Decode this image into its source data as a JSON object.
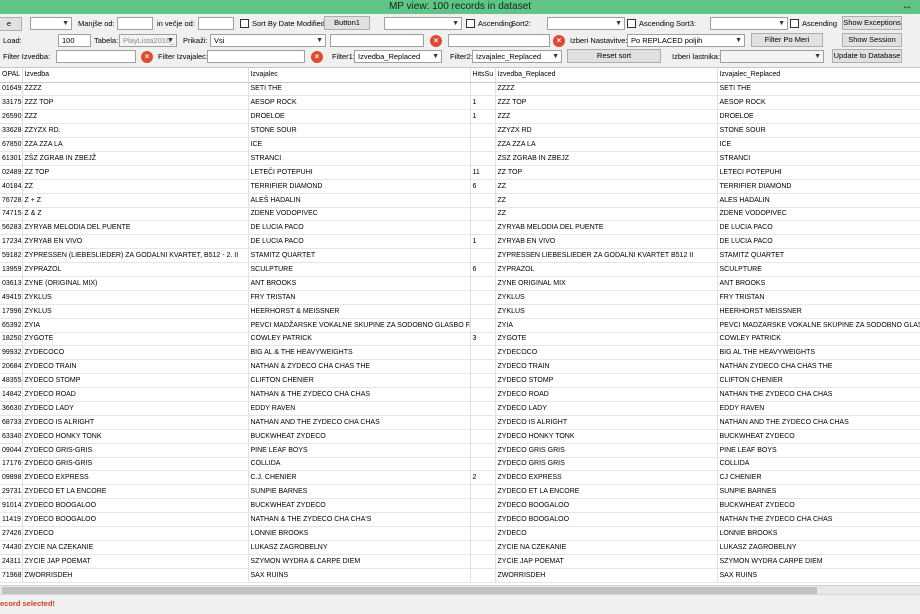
{
  "window": {
    "title": "MP view: 100 records in dataset",
    "resize_glyph": "↔"
  },
  "toolbar1": {
    "edge_button": "e",
    "manjse_label": "Manjše od:",
    "vecje_label": "in večje od:",
    "sort_by_date_label": "Sort By Date Modified",
    "button1_label": "Button1",
    "ascending1_label": "Ascending",
    "sort2_label": "Sort2:",
    "ascending2_label": "Ascending",
    "sort3_label": "Sort3:",
    "ascending3_label": "Ascending",
    "show_exceptions_label": "Show Exceptions"
  },
  "toolbar2": {
    "load_label": "Load:",
    "load_value": "100",
    "tabela_label": "Tabela:",
    "tabela_value": "PlayLista2016_",
    "prikazi_label": "Prikaži:",
    "prikazi_value": "Vsi",
    "izberi_nastavitve_label": "Izberi Nastavitve:",
    "nastavitve_value": "Po REPLACED poljih",
    "filter_po_meri_label": "Filter Po Meri",
    "show_session_label": "Show Session"
  },
  "toolbar3": {
    "filter_izvedba_label": "Filter Izvedba:",
    "filter_izvajalec_label": "Filter Izvajalec:",
    "filter1_label": "Filter1:",
    "filter1_value": "Izvedba_Replaced",
    "filter2_label": "Filter2:",
    "filter2_value": "Izvajalec_Replaced",
    "reset_sort_label": "Reset sort",
    "izberi_lastnika_label": "Izberi lastnika:",
    "update_db_label": "Update to Database"
  },
  "grid": {
    "columns": [
      "OPAL",
      "Izvedba",
      "Izvajalec",
      "HitsSu",
      "Izvedba_Replaced",
      "Izvajalec_Replaced"
    ],
    "rows": [
      [
        "01649",
        "ZZZZ",
        "SETI THE",
        "",
        "ZZZZ",
        "SETI THE"
      ],
      [
        "33175",
        "ZZZ TOP",
        "AESOP ROCK",
        "1",
        "ZZZ TOP",
        "AESOP ROCK"
      ],
      [
        "26590",
        "ZZZ",
        "DROELOE",
        "1",
        "ZZZ",
        "DROELOE"
      ],
      [
        "33628",
        "ZZYZX RD.",
        "STONE SOUR",
        "",
        "ZZYZX RD",
        "STONE SOUR"
      ],
      [
        "67850",
        "ZZA ZZA LA",
        "ICE",
        "",
        "ZZA ZZA LA",
        "ICE"
      ],
      [
        "61301",
        "ZŠZ ZGRAB IN ZBEJŽ",
        "STRANCI",
        "",
        "ZSZ ZGRAB IN ZBEJZ",
        "STRANCI"
      ],
      [
        "02489",
        "ZZ TOP",
        "LETEČI POTEPUHI",
        "11",
        "ZZ TOP",
        "LETECI POTEPUHI"
      ],
      [
        "40184",
        "ZZ",
        "TERRIFIER DIAMOND",
        "6",
        "ZZ",
        "TERRIFIER DIAMOND"
      ],
      [
        "76728",
        "Z + Z",
        "ALEŠ HADALIN",
        "",
        "ZZ",
        "ALES HADALIN"
      ],
      [
        "74715",
        "Z & Z",
        "ZDENE VODOPIVEC",
        "",
        "ZZ",
        "ZDENE VODOPIVEC"
      ],
      [
        "56283",
        "ZYRYAB MELODIA DEL PUENTE",
        "DE LUCIA PACO",
        "",
        "ZYRYAB MELODIA DEL PUENTE",
        "DE LUCIA PACO"
      ],
      [
        "17234",
        "ZYRYAB EN VIVO",
        "DE LUCIA PACO",
        "1",
        "ZYRYAB EN VIVO",
        "DE LUCIA PACO"
      ],
      [
        "59182",
        "ZYPRESSEN (LIEBESLIEDER) ZA GODALNI KVARTET, B512 - 2. II",
        "STAMITZ QUARTET",
        "",
        "ZYPRESSEN LIEBESLIEDER ZA GODALNI KVARTET B512 II",
        "STAMITZ QUARTET"
      ],
      [
        "13959",
        "ZYPRAZOL",
        "SCULPTURE",
        "6",
        "ZYPRAZOL",
        "SCULPTURE"
      ],
      [
        "03613",
        "ZYNE (ORIGINAL MIX)",
        "ANT BROOKS",
        "",
        "ZYNE ORIGINAL MIX",
        "ANT BROOKS"
      ],
      [
        "49415",
        "ZYKLUS",
        "FRY TRISTAN",
        "",
        "ZYKLUS",
        "FRY TRISTAN"
      ],
      [
        "17996",
        "ZYKLUS",
        "HEERHORST & MEISSNER",
        "",
        "ZYKLUS",
        "HEERHORST MEISSNER"
      ],
      [
        "65392",
        "ZYIA",
        "PEVCI MADŽARSKE VOKALNE SKUPINE ZA SODOBNO GLASBO F...",
        "",
        "ZYIA",
        "PEVCI MADZARSKE VOKALNE SKUPINE ZA SODOBNO GLASBO"
      ],
      [
        "18250",
        "ZYGOTE",
        "COWLEY PATRICK",
        "3",
        "ZYGOTE",
        "COWLEY PATRICK"
      ],
      [
        "99932",
        "ZYDECOCO",
        "BIG AL & THE HEAVYWEIGHTS",
        "",
        "ZYDECOCO",
        "BIG AL THE HEAVYWEIGHTS"
      ],
      [
        "20684",
        "ZYDECO TRAIN",
        "NATHAN & ZYDECO CHA CHAS THE",
        "",
        "ZYDECO TRAIN",
        "NATHAN ZYDECO CHA CHAS THE"
      ],
      [
        "48355",
        "ZYDECO STOMP",
        "CLIFTON CHENIER",
        "",
        "ZYDECO STOMP",
        "CLIFTON CHENIER"
      ],
      [
        "14842",
        "ZYDECO ROAD",
        "NATHAN & THE ZYDECO CHA CHAS",
        "",
        "ZYDECO ROAD",
        "NATHAN THE ZYDECO CHA CHAS"
      ],
      [
        "36630",
        "ZYDECO LADY",
        "EDDY RAVEN",
        "",
        "ZYDECO LADY",
        "EDDY RAVEN"
      ],
      [
        "68733",
        "ZYDECO IS ALRIGHT",
        "NATHAN AND THE ZYDECO CHA CHAS",
        "",
        "ZYDECO IS ALRIGHT",
        "NATHAN AND THE ZYDECO CHA CHAS"
      ],
      [
        "63340",
        "ZYDECO HONKY TONK",
        "BUCKWHEAT ZYDECO",
        "",
        "ZYDECO HONKY TONK",
        "BUCKWHEAT ZYDECO"
      ],
      [
        "09044",
        "ZYDECO GRIS-GRIS",
        "PINE LEAF BOYS",
        "",
        "ZYDECO GRIS GRIS",
        "PINE LEAF BOYS"
      ],
      [
        "17176",
        "ZYDECO GRIS-GRIS",
        "COLLIDA",
        "",
        "ZYDECO GRIS GRIS",
        "COLLIDA"
      ],
      [
        "09898",
        "ZYDECO EXPRESS",
        "C.J. CHENIER",
        "2",
        "ZYDECO EXPRESS",
        "CJ CHENIER"
      ],
      [
        "29731",
        "ZYDECO ET LA ENCORE",
        "SUNPIE BARNES",
        "",
        "ZYDECO ET LA ENCORE",
        "SUNPIE BARNES"
      ],
      [
        "91014",
        "ZYDECO BOOGALOO",
        "BUCKWHEAT ZYDECO",
        "",
        "ZYDECO BOOGALOO",
        "BUCKWHEAT ZYDECO"
      ],
      [
        "11419",
        "ZYDECO BOOGALOO",
        "NATHAN & THE ZYDECO CHA CHA'S",
        "",
        "ZYDECO BOOGALOO",
        "NATHAN THE ZYDECO CHA CHAS"
      ],
      [
        "27426",
        "ZYDECO",
        "LONNIE BROOKS",
        "",
        "ZYDECO",
        "LONNIE BROOKS"
      ],
      [
        "74430",
        "ZYCIE NA CZEKANIE",
        "LUKASZ ZAGROBELNY",
        "",
        "ZYCIE NA CZEKANIE",
        "LUKASZ ZAGROBELNY"
      ],
      [
        "24311",
        "ZYCIE JAP POEMAT",
        "SZYMON WYDRA & CARPE DIEM",
        "",
        "ZYCIE JAP POEMAT",
        "SZYMON WYDRA CARPE DIEM"
      ],
      [
        "71968",
        "ZWORRISDEH",
        "SAX RUINS",
        "",
        "ZWORRISDEH",
        "SAX RUINS"
      ]
    ]
  },
  "status": {
    "message": "ecord selected!"
  },
  "icons": {
    "clear": "clear-icon",
    "dropdown": "chevron-down-icon"
  },
  "colors": {
    "titlebar": "#5fc485",
    "status_text": "#d2411f",
    "clear_button": "#e04a2f"
  }
}
